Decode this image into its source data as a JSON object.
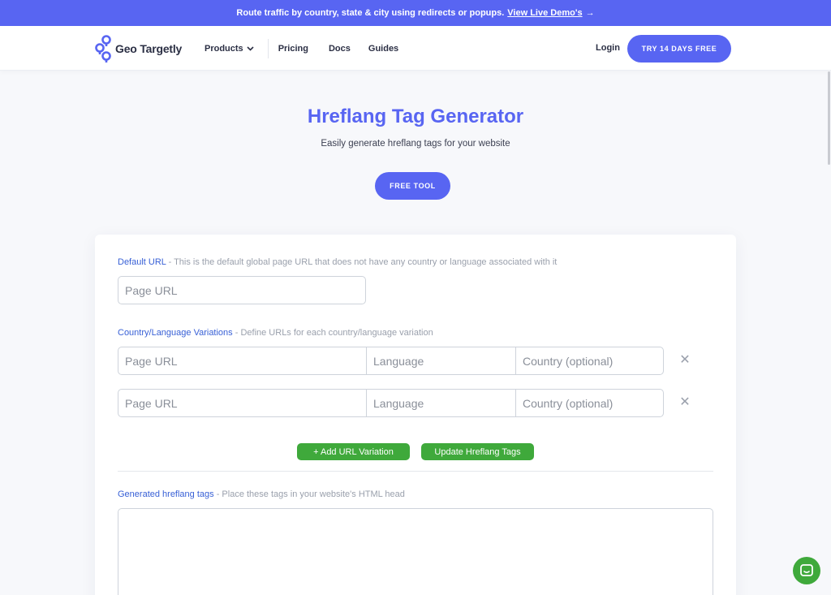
{
  "banner": {
    "text": "Route traffic by country, state & city using redirects or popups.",
    "link": "View Live Demo's",
    "arrow": "→"
  },
  "nav": {
    "logo_text": "Geo Targetly",
    "products": "Products",
    "pricing": "Pricing",
    "docs": "Docs",
    "guides": "Guides",
    "login": "Login",
    "cta": "TRY 14 DAYS FREE"
  },
  "hero": {
    "title": "Hreflang Tag Generator",
    "subtitle": "Easily generate hreflang tags for your website",
    "badge": "FREE TOOL"
  },
  "form": {
    "default_url": {
      "label": "Default URL",
      "hint": " - This is the default global page URL that does not have any country or language associated with it",
      "placeholder": "Page URL"
    },
    "variations": {
      "label": "Country/Language Variations",
      "hint": " - Define URLs for each country/language variation",
      "rows": [
        {
          "url_placeholder": "Page URL",
          "lang_placeholder": "Language",
          "country_placeholder": "Country (optional)",
          "remove": "✕"
        },
        {
          "url_placeholder": "Page URL",
          "lang_placeholder": "Language",
          "country_placeholder": "Country (optional)",
          "remove": "✕"
        }
      ]
    },
    "add_button": "+ Add URL Variation",
    "update_button": "Update Hreflang Tags",
    "output": {
      "label": "Generated hreflang tags",
      "hint": " - Place these tags in your website's HTML head",
      "value": ""
    }
  },
  "colors": {
    "brand": "#5865f2",
    "green": "#3fa93b",
    "label_blue": "#3860d6"
  }
}
